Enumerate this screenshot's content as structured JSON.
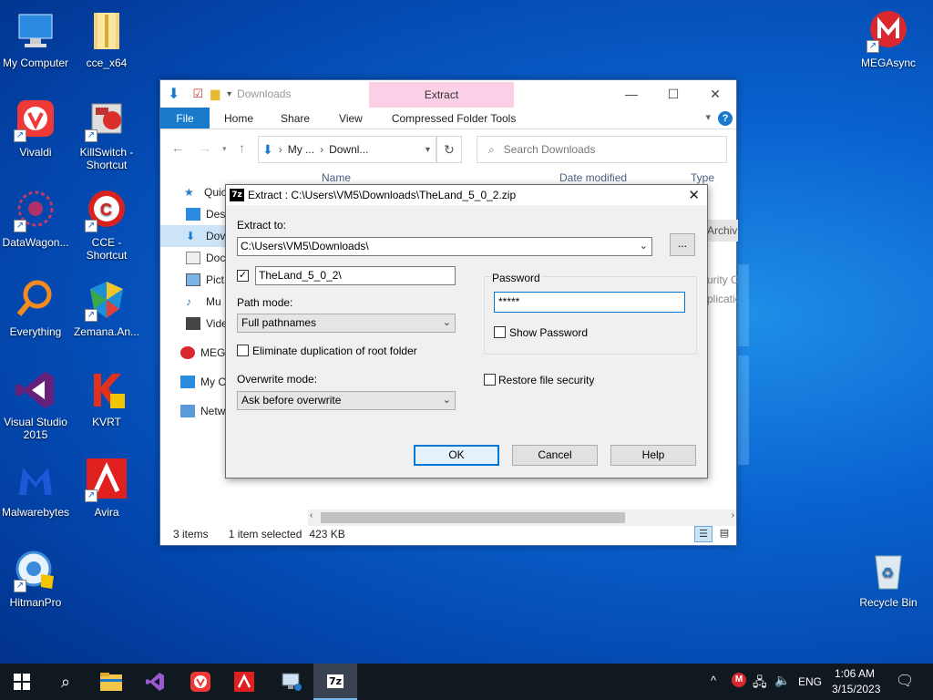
{
  "desktop": {
    "icons": [
      {
        "label": "My Computer"
      },
      {
        "label": "cce_x64"
      },
      {
        "label": "Vivaldi"
      },
      {
        "label": "KillSwitch - Shortcut"
      },
      {
        "label": "DataWagon..."
      },
      {
        "label": "CCE - Shortcut"
      },
      {
        "label": "Everything"
      },
      {
        "label": "Zemana.An..."
      },
      {
        "label": "Visual Studio 2015"
      },
      {
        "label": "KVRT"
      },
      {
        "label": "Malwarebytes"
      },
      {
        "label": "Avira"
      },
      {
        "label": "HitmanPro"
      },
      {
        "label": "MEGAsync"
      },
      {
        "label": "Recycle Bin"
      }
    ]
  },
  "explorer": {
    "title": "Downloads",
    "context_tab": "Extract",
    "tabs": [
      "File",
      "Home",
      "Share",
      "View",
      "Compressed Folder Tools"
    ],
    "address": {
      "seg1": "My ...",
      "seg2": "Downl..."
    },
    "search_placeholder": "Search Downloads",
    "columns": {
      "name": "Name",
      "date": "Date modified",
      "type": "Type"
    },
    "nav": [
      "Quick access",
      "Desktop",
      "Downloads",
      "Documents",
      "Pictures",
      "Music",
      "Videos",
      "MEGA",
      "My Computer",
      "Network"
    ],
    "nav_visible": [
      "Quicl",
      "Des",
      "Dov",
      "Doc",
      "Pict",
      "Mu",
      "Vide",
      "MEG",
      "My C",
      "Netw"
    ],
    "file_partial": [
      "Archiv",
      "urity C",
      "plicatio"
    ],
    "status": {
      "items": "3 items",
      "selected": "1 item selected",
      "size": "423 KB"
    }
  },
  "dialog": {
    "badge": "7z",
    "title": "Extract : C:\\Users\\VM5\\Downloads\\TheLand_5_0_2.zip",
    "extract_to_label": "Extract to:",
    "extract_to_value": "C:\\Users\\VM5\\Downloads\\",
    "browse_label": "...",
    "subfolder_value": "TheLand_5_0_2\\",
    "subfolder_checked": true,
    "path_mode_label": "Path mode:",
    "path_mode_value": "Full pathnames",
    "eliminate_dup_label": "Eliminate duplication of root folder",
    "overwrite_mode_label": "Overwrite mode:",
    "overwrite_mode_value": "Ask before overwrite",
    "password_group_label": "Password",
    "password_value": "*****",
    "show_password_label": "Show Password",
    "restore_security_label": "Restore file security",
    "ok_label": "OK",
    "cancel_label": "Cancel",
    "help_label": "Help"
  },
  "taskbar": {
    "lang": "ENG",
    "time": "1:06 AM",
    "date": "3/15/2023"
  }
}
